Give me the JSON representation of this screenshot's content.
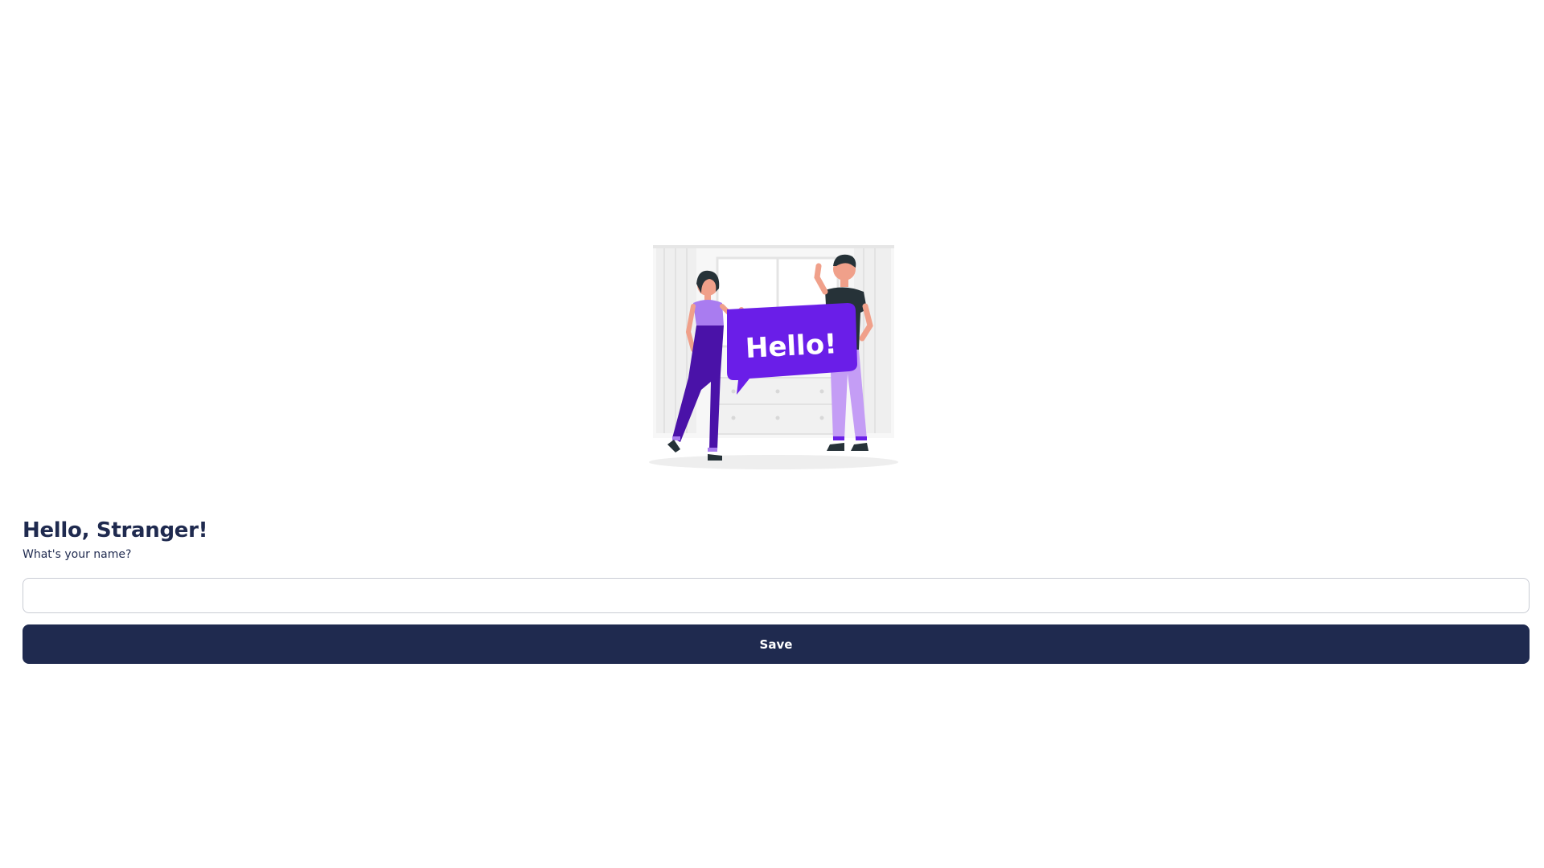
{
  "illustration": {
    "icon": "hello-people-illustration",
    "bubble_text": "Hello!",
    "colors": {
      "accent": "#6a1ee8",
      "accent_light": "#a97cf0",
      "accent_dark": "#4a12a8"
    }
  },
  "form": {
    "greeting": "Hello, Stranger!",
    "prompt": "What's your name?",
    "name_value": "",
    "name_placeholder": "",
    "save_label": "Save"
  },
  "colors": {
    "text": "#1f2a4f",
    "button_bg": "#1f2a4f",
    "button_text": "#ffffff",
    "input_border": "#c9ccd4"
  }
}
